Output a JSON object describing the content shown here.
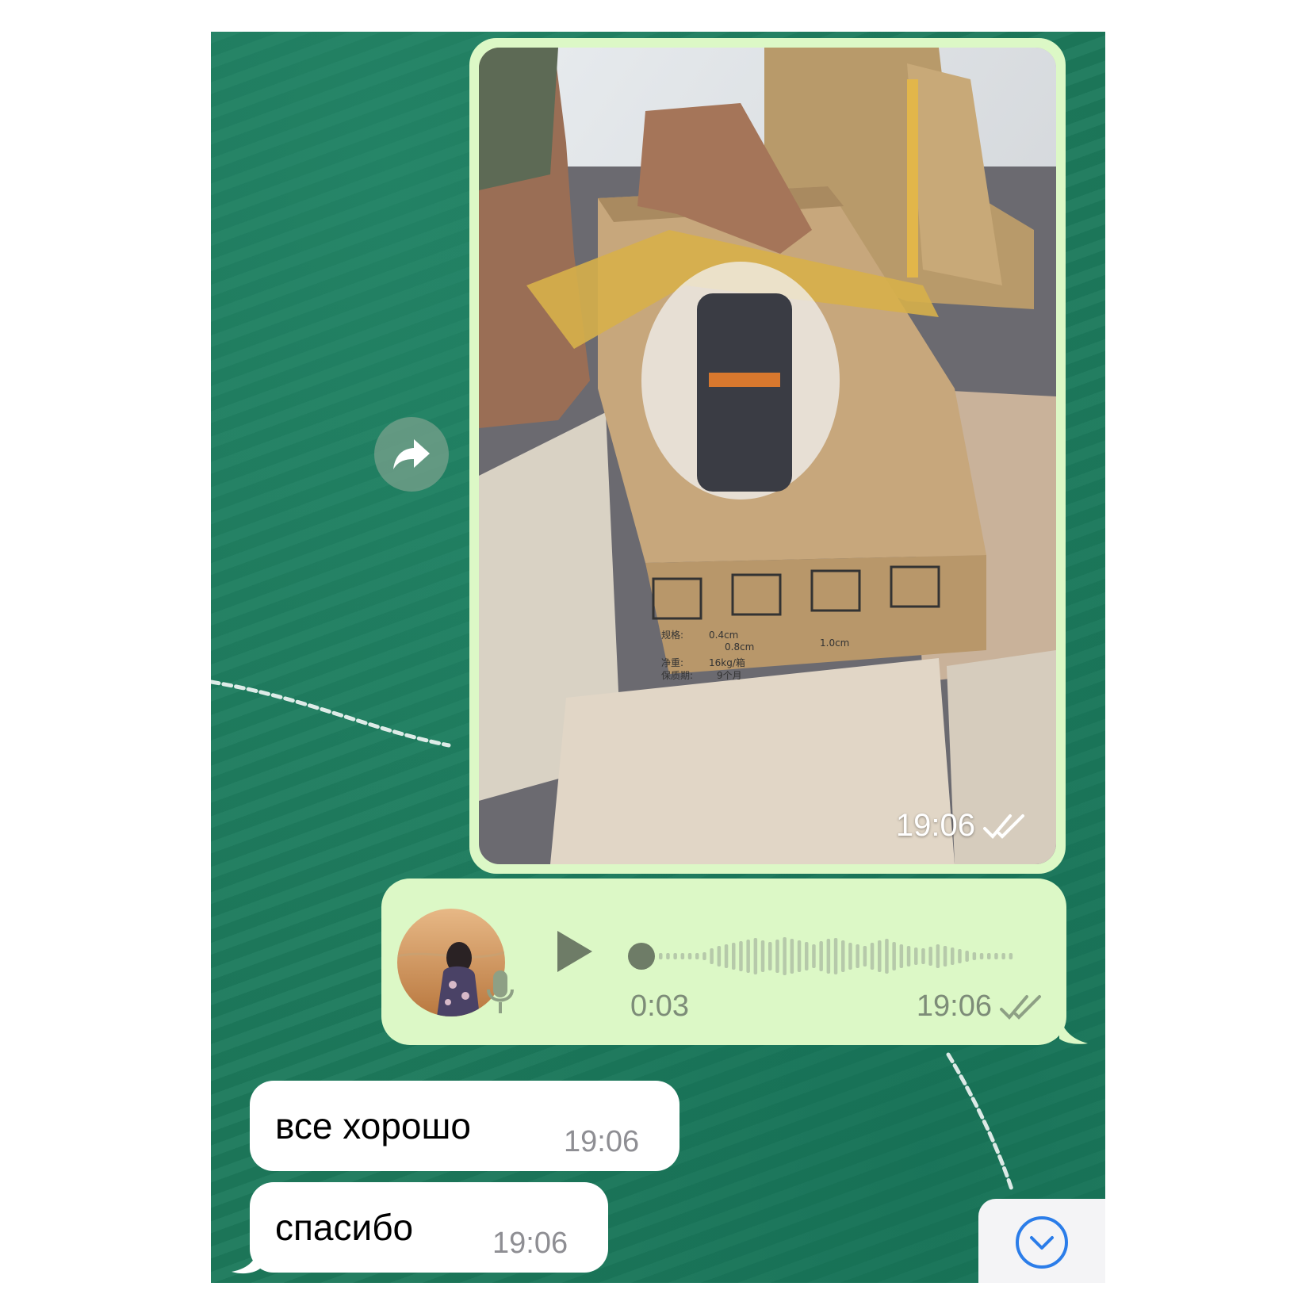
{
  "chat": {
    "media_message": {
      "time": "19:06",
      "status": "read",
      "box_labels": [
        "规格:",
        "0.4cm",
        "0.8cm",
        "1.0cm",
        "净重:",
        "16kg/箱",
        "保质期:",
        "9个月"
      ]
    },
    "voice_message": {
      "duration": "0:03",
      "time": "19:06",
      "status": "read",
      "progress": 0
    },
    "incoming_messages": [
      {
        "text": "все хорошо",
        "time": "19:06"
      },
      {
        "text": "спасибо",
        "time": "19:06"
      }
    ]
  },
  "icons": {
    "forward": "forward-arrow-icon",
    "play": "play-icon",
    "mic": "microphone-icon",
    "read": "double-check-icon",
    "scroll": "chevron-down-icon"
  },
  "colors": {
    "outgoing_bubble": "#dcf8c6",
    "incoming_bubble": "#ffffff",
    "wallpaper": "#1d7a5c",
    "accent_blue": "#2b7de9",
    "voice_meta": "#7d8c78"
  }
}
